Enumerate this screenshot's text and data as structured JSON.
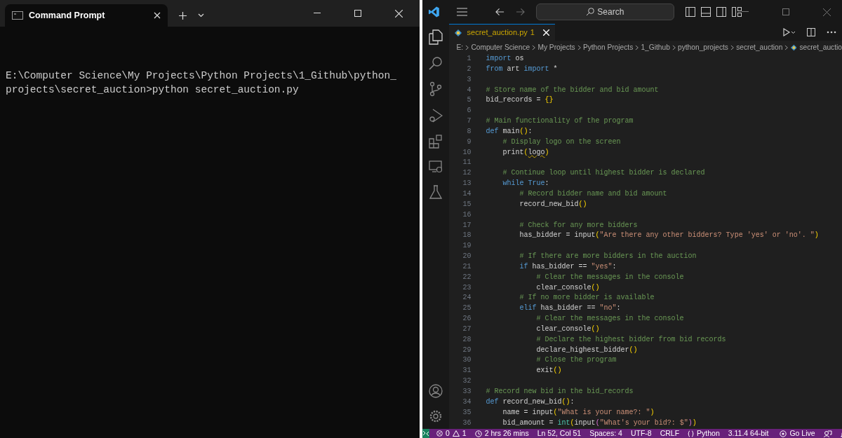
{
  "terminal": {
    "tab_title": "Command Prompt",
    "lines": [
      "E:\\Computer Science\\My Projects\\Python Projects\\1_Github\\python_",
      "projects\\secret_auction>python secret_auction.py"
    ]
  },
  "editor": {
    "search_placeholder": "Search",
    "tab": {
      "label": "secret_auction.py",
      "problems": "1"
    },
    "breadcrumbs": [
      "E:",
      "Computer Science",
      "My Projects",
      "Python Projects",
      "1_Github",
      "python_projects",
      "secret_auction",
      "secret_auctio"
    ],
    "lines": [
      {
        "number": "1",
        "tokens": [
          {
            "kind": "kw",
            "text": "import"
          },
          {
            "kind": "plain",
            "text": " os"
          }
        ]
      },
      {
        "number": "2",
        "tokens": [
          {
            "kind": "kw",
            "text": "from"
          },
          {
            "kind": "plain",
            "text": " art "
          },
          {
            "kind": "kw",
            "text": "import"
          },
          {
            "kind": "plain",
            "text": " *"
          }
        ]
      },
      {
        "number": "3"
      },
      {
        "number": "4",
        "tokens": [
          {
            "kind": "comment",
            "text": "# Store name of the bidder and bid amount"
          }
        ]
      },
      {
        "number": "5",
        "tokens": [
          {
            "kind": "plain",
            "text": "bid_records = "
          },
          {
            "kind": "bracket",
            "text": "{}"
          }
        ]
      },
      {
        "number": "6"
      },
      {
        "number": "7",
        "tokens": [
          {
            "kind": "comment",
            "text": "# Main functionality of the program"
          }
        ]
      },
      {
        "number": "8",
        "tokens": [
          {
            "kind": "kw",
            "text": "def"
          },
          {
            "kind": "plain",
            "text": " main"
          },
          {
            "kind": "bracket",
            "text": "()"
          },
          {
            "kind": "plain",
            "text": ":"
          }
        ]
      },
      {
        "number": "9",
        "tokens": [
          {
            "kind": "comment",
            "text": "    # Display logo on the screen"
          }
        ]
      },
      {
        "number": "10",
        "tokens": [
          {
            "kind": "plain",
            "text": "    print"
          },
          {
            "kind": "bracket",
            "text": "("
          },
          {
            "kind": "warn",
            "text": "logo"
          },
          {
            "kind": "bracket",
            "text": ")"
          }
        ]
      },
      {
        "number": "11"
      },
      {
        "number": "12",
        "tokens": [
          {
            "kind": "comment",
            "text": "    # Continue loop until highest bidder is declared"
          }
        ]
      },
      {
        "number": "13",
        "tokens": [
          {
            "kind": "kw",
            "text": "    while True"
          },
          {
            "kind": "plain",
            "text": ":"
          }
        ]
      },
      {
        "number": "14",
        "tokens": [
          {
            "kind": "comment",
            "text": "        # Record bidder name and bid amount"
          }
        ]
      },
      {
        "number": "15",
        "tokens": [
          {
            "kind": "plain",
            "text": "        record_new_bid"
          },
          {
            "kind": "bracket",
            "text": "()"
          }
        ]
      },
      {
        "number": "16"
      },
      {
        "number": "17",
        "tokens": [
          {
            "kind": "comment",
            "text": "        # Check for any more bidders"
          }
        ]
      },
      {
        "number": "18",
        "tokens": [
          {
            "kind": "plain",
            "text": "        has_bidder = input"
          },
          {
            "kind": "bracket",
            "text": "("
          },
          {
            "kind": "string",
            "text": "\"Are there any other bidders? Type 'yes' or 'no'. \""
          },
          {
            "kind": "bracket",
            "text": ")"
          }
        ]
      },
      {
        "number": "19"
      },
      {
        "number": "20",
        "tokens": [
          {
            "kind": "comment",
            "text": "        # If there are more bidders in the auction"
          }
        ]
      },
      {
        "number": "21",
        "tokens": [
          {
            "kind": "kw",
            "text": "        if"
          },
          {
            "kind": "plain",
            "text": " has_bidder == "
          },
          {
            "kind": "string",
            "text": "\"yes\""
          },
          {
            "kind": "plain",
            "text": ":"
          }
        ]
      },
      {
        "number": "22",
        "tokens": [
          {
            "kind": "comment",
            "text": "            # Clear the messages in the console"
          }
        ]
      },
      {
        "number": "23",
        "tokens": [
          {
            "kind": "plain",
            "text": "            clear_console"
          },
          {
            "kind": "bracket",
            "text": "()"
          }
        ]
      },
      {
        "number": "24",
        "tokens": [
          {
            "kind": "comment",
            "text": "        # If no more bidder is available"
          }
        ]
      },
      {
        "number": "25",
        "tokens": [
          {
            "kind": "kw",
            "text": "        elif"
          },
          {
            "kind": "plain",
            "text": " has_bidder == "
          },
          {
            "kind": "string",
            "text": "\"no\""
          },
          {
            "kind": "plain",
            "text": ":"
          }
        ]
      },
      {
        "number": "26",
        "tokens": [
          {
            "kind": "comment",
            "text": "            # Clear the messages in the console"
          }
        ]
      },
      {
        "number": "27",
        "tokens": [
          {
            "kind": "plain",
            "text": "            clear_console"
          },
          {
            "kind": "bracket",
            "text": "()"
          }
        ]
      },
      {
        "number": "28",
        "tokens": [
          {
            "kind": "comment",
            "text": "            # Declare the highest bidder from bid records"
          }
        ]
      },
      {
        "number": "29",
        "tokens": [
          {
            "kind": "plain",
            "text": "            declare_highest_bidder"
          },
          {
            "kind": "bracket",
            "text": "()"
          }
        ]
      },
      {
        "number": "30",
        "tokens": [
          {
            "kind": "comment",
            "text": "            # Close the program"
          }
        ]
      },
      {
        "number": "31",
        "tokens": [
          {
            "kind": "plain",
            "text": "            exit"
          },
          {
            "kind": "bracket",
            "text": "()"
          }
        ]
      },
      {
        "number": "32"
      },
      {
        "number": "33",
        "tokens": [
          {
            "kind": "comment",
            "text": "# Record new bid in the bid_records"
          }
        ]
      },
      {
        "number": "34",
        "tokens": [
          {
            "kind": "kw",
            "text": "def"
          },
          {
            "kind": "plain",
            "text": " record_new_bid"
          },
          {
            "kind": "bracket",
            "text": "()"
          },
          {
            "kind": "plain",
            "text": ":"
          }
        ]
      },
      {
        "number": "35",
        "tokens": [
          {
            "kind": "plain",
            "text": "    name = input"
          },
          {
            "kind": "bracket",
            "text": "("
          },
          {
            "kind": "string",
            "text": "\"What is your name?: \""
          },
          {
            "kind": "bracket",
            "text": ")"
          }
        ]
      },
      {
        "number": "36",
        "tokens": [
          {
            "kind": "plain",
            "text": "    bid_amount = "
          },
          {
            "kind": "builtin",
            "text": "int"
          },
          {
            "kind": "bracket",
            "text": "("
          },
          {
            "kind": "plain",
            "text": "input"
          },
          {
            "kind": "bracket2",
            "text": "("
          },
          {
            "kind": "string",
            "text": "\"What's your bid?: $\""
          },
          {
            "kind": "bracket2",
            "text": ")"
          },
          {
            "kind": "bracket",
            "text": ")"
          }
        ]
      }
    ]
  },
  "status_bar": {
    "errors": "0",
    "warnings": "1",
    "items": [
      {
        "kind": "clock",
        "text": "2 hrs 26 mins"
      },
      {
        "kind": "spacer"
      },
      {
        "kind": "text",
        "text": "Ln 52, Col 51"
      },
      {
        "kind": "text",
        "text": "Spaces: 4"
      },
      {
        "kind": "text",
        "text": "UTF-8"
      },
      {
        "kind": "text",
        "text": "CRLF"
      },
      {
        "kind": "language",
        "text": "Python"
      },
      {
        "kind": "text",
        "text": "3.11.4 64-bit"
      },
      {
        "kind": "live",
        "text": "Go Live"
      },
      {
        "kind": "feedback"
      },
      {
        "kind": "bell"
      }
    ]
  }
}
